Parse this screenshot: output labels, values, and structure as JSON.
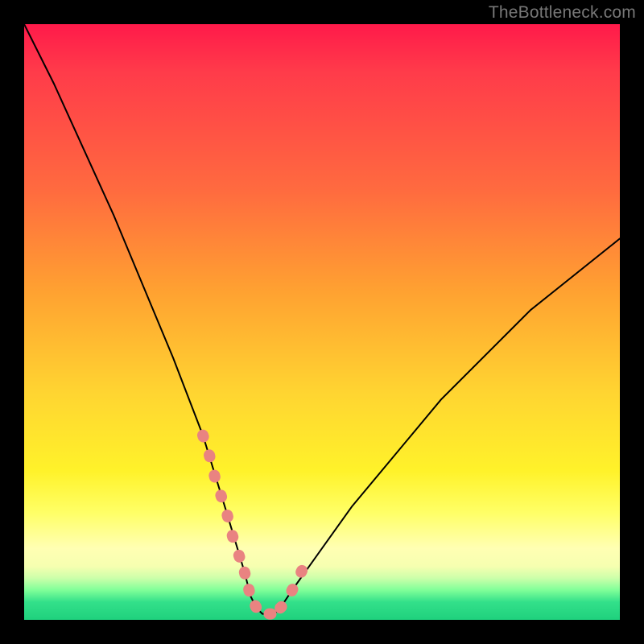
{
  "watermark": "TheBottleneck.com",
  "colors": {
    "bg": "#000000",
    "curve_stroke": "#000000",
    "pink_stroke": "#e98381",
    "gradient_top": "#ff1a4a",
    "gradient_bottom": "#1fd17d"
  },
  "chart_data": {
    "type": "line",
    "title": "",
    "xlabel": "",
    "ylabel": "",
    "xlim": [
      0,
      100
    ],
    "ylim": [
      0,
      100
    ],
    "series": [
      {
        "name": "bottleneck-curve",
        "x": [
          0,
          5,
          10,
          15,
          20,
          25,
          30,
          34,
          37,
          38,
          39,
          40,
          41,
          42,
          43,
          45,
          50,
          55,
          60,
          65,
          70,
          75,
          80,
          85,
          90,
          95,
          100
        ],
        "values": [
          100,
          90,
          79,
          68,
          56,
          44,
          31,
          18,
          8,
          4,
          2,
          1,
          1,
          1,
          2,
          5,
          12,
          19,
          25,
          31,
          37,
          42,
          47,
          52,
          56,
          60,
          64
        ]
      }
    ],
    "annotations": [
      {
        "name": "pink-segment-left",
        "x": [
          30,
          31,
          32,
          33,
          34,
          35,
          36,
          37
        ],
        "values": [
          31,
          28,
          24,
          21,
          18,
          14,
          11,
          8
        ]
      },
      {
        "name": "pink-segment-bottom",
        "x": [
          37,
          38,
          39,
          40,
          41,
          42,
          43
        ],
        "values": [
          8,
          4,
          2,
          1,
          1,
          1,
          2
        ]
      },
      {
        "name": "pink-segment-right",
        "x": [
          43,
          44,
          45,
          46,
          47
        ],
        "values": [
          2,
          3,
          5,
          7,
          9
        ]
      }
    ]
  }
}
